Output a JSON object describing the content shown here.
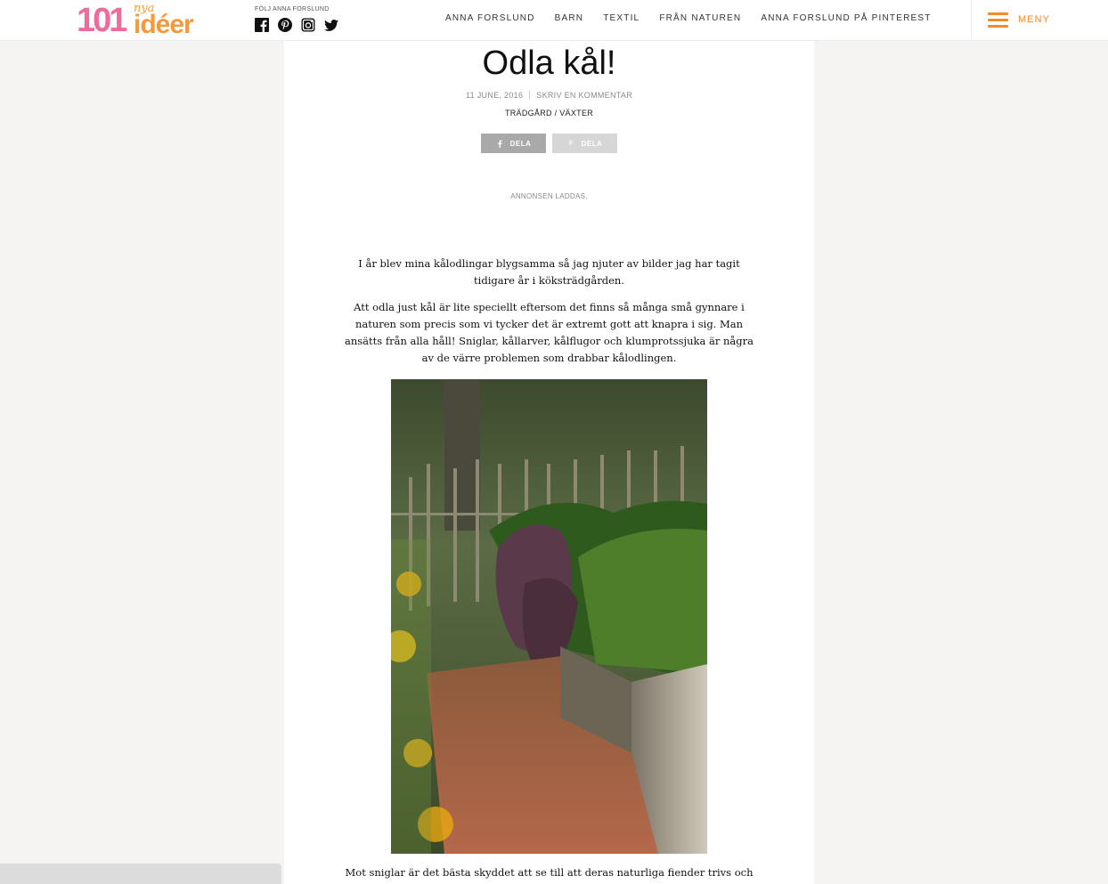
{
  "header": {
    "logo": {
      "number": "101",
      "script": "nya",
      "word": "idéer"
    },
    "follow_label": "FÖLJ ANNA FORSLUND",
    "social_icons": [
      "facebook-icon",
      "pinterest-icon",
      "instagram-icon",
      "twitter-icon"
    ],
    "nav": [
      "ANNA FORSLUND",
      "BARN",
      "TEXTIL",
      "FRÅN NATUREN",
      "ANNA FORSLUND PÅ PINTEREST"
    ],
    "menu_label": "MENY"
  },
  "article": {
    "title": "Odla kål!",
    "date": "11 JUNE, 2016",
    "comment_link": "SKRIV EN KOMMENTAR",
    "category_1": "TRÄDGÅRD",
    "category_separator": " / ",
    "category_2": "VÄXTER",
    "share_facebook": "DELA",
    "share_pinterest": "DELA",
    "ad_notice": "ANNONSEN LADDAS.",
    "paragraph_1": "I år blev mina kålodlingar blygsamma så jag njuter av bilder jag har tagit tidigare år i köksträdgården.",
    "paragraph_2": "Att odla just kål är lite speciellt eftersom det finns så många små gynnare i naturen som precis som vi tycker det är extremt gott att knapra i sig. Man ansätts från alla håll! Sniglar, kållarver, kålflugor och klumprotssjuka är några av de värre problemen som drabbar kålodlingen.",
    "paragraph_3": "Mot sniglar är det bästa skyddet att se till att deras naturliga fiender trivs och sedan får"
  },
  "colors": {
    "brand_pink": "#f06a9c",
    "brand_orange": "#f49a3a",
    "menu_orange": "#f28c2a",
    "page_bg": "#f5f4f2"
  }
}
